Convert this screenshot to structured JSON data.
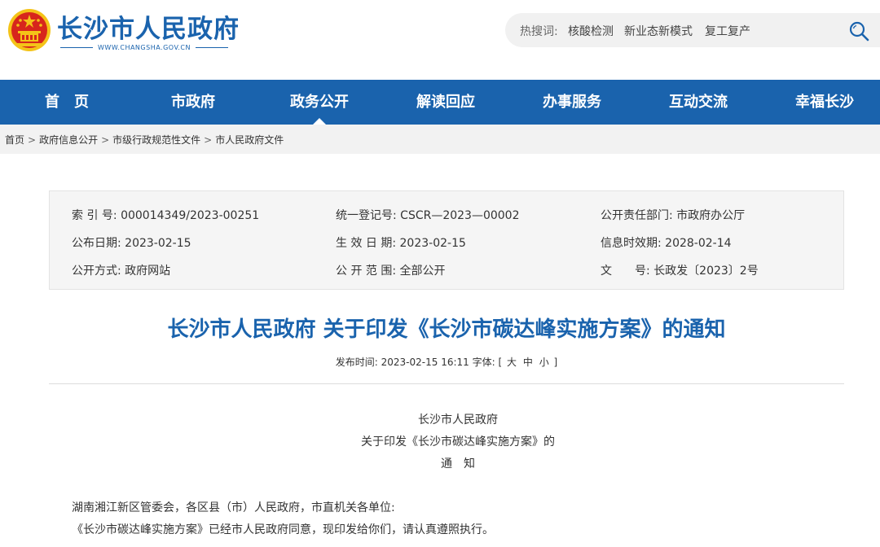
{
  "header": {
    "site_name": "长沙市人民政府",
    "domain": "WWW.CHANGSHA.GOV.CN",
    "hot_search_label": "热搜词:",
    "hot_search_items": [
      "核酸检测",
      "新业态新模式",
      "复工复产"
    ],
    "search_icon": "search-icon",
    "emblem_icon": "national-emblem-icon"
  },
  "colors": {
    "brand_blue": "#1a63ad",
    "emblem_red": "#d7261c",
    "emblem_gold": "#f4c318"
  },
  "nav": {
    "items": [
      "首　页",
      "市政府",
      "政务公开",
      "解读回应",
      "办事服务",
      "互动交流",
      "幸福长沙"
    ],
    "active": "政务公开"
  },
  "breadcrumb": [
    "首页",
    "政府信息公开",
    "市级行政规范性文件",
    "市人民政府文件"
  ],
  "meta": {
    "index_no": "索 引 号:  000014349/2023-00251",
    "reg_no": "统一登记号:  CSCR—2023—00002",
    "dept": "公开责任部门:  市政府办公厅",
    "pub_date": "公布日期:  2023-02-15",
    "effective_date": "生 效 日 期:  2023-02-15",
    "expiry": "信息时效期:  2028-02-14",
    "method": "公开方式:  政府网站",
    "scope": "公 开 范 围:  全部公开",
    "doc_no": "文　　号:  长政发〔2023〕2号"
  },
  "article": {
    "title": "长沙市人民政府 关于印发《长沙市碳达峰实施方案》的通知",
    "published_label": "发布时间:",
    "published_time": "2023-02-15 16:11",
    "font_size_label": "字体:",
    "font_open": "[",
    "font_large": "大",
    "font_medium": "中",
    "font_small": "小",
    "font_close": "]",
    "heading_lines": [
      "长沙市人民政府",
      "关于印发《长沙市碳达峰实施方案》的",
      "通　知"
    ],
    "paragraphs": [
      "湖南湘江新区管委会，各区县（市）人民政府，市直机关各单位:",
      "《长沙市碳达峰实施方案》已经市人民政府同意，现印发给你们，请认真遵照执行。"
    ]
  }
}
